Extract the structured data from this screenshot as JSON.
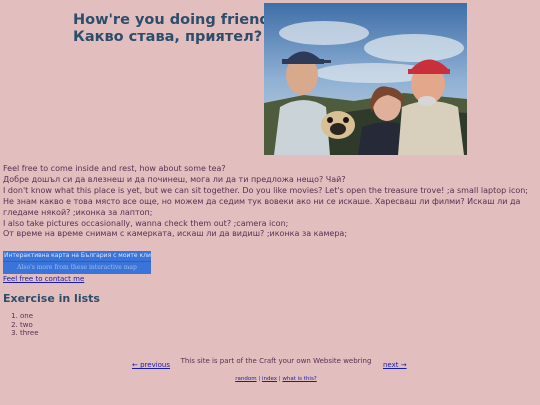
{
  "header": {
    "title_en": "How're you doing friend?",
    "title_bg": "Какво става, приятел?"
  },
  "intro": {
    "lines": [
      "Feel free to come inside and rest, how about some tea?",
      "Добре дошъл си да влезнеш и да починеш, мога ли да ти предложа нещо? Чай?",
      "I don't know what this place is yet, but we can sit together. Do you like movies? Let's open the treasure trove! ;a small laptop icon;",
      "Не знам какво е това място все още, но можем да седим тук вовеки ако ни се искаше. Харесваш ли филми? Искаш ли да гледаме някой? ;иконка за лаптоп;",
      "I also take pictures occasionally, wanna check them out? ;camera icon;",
      "От време на време снимам с камерката, искаш ли да видиш? ;иконка за камера;"
    ]
  },
  "map_widget": {
    "title": "Интерактивна карта на България с моите клипове",
    "link": "Also's more from these interactive map"
  },
  "contact_link": "Feel free to contact me",
  "exercise": {
    "title": "Exercise in lists",
    "items": [
      "one",
      "two",
      "three"
    ]
  },
  "webring": {
    "prev": "← previous",
    "next": "next →",
    "text": "This site is part of the Craft your own Website webring",
    "random": "random",
    "index": "index",
    "what": "what is this?"
  }
}
